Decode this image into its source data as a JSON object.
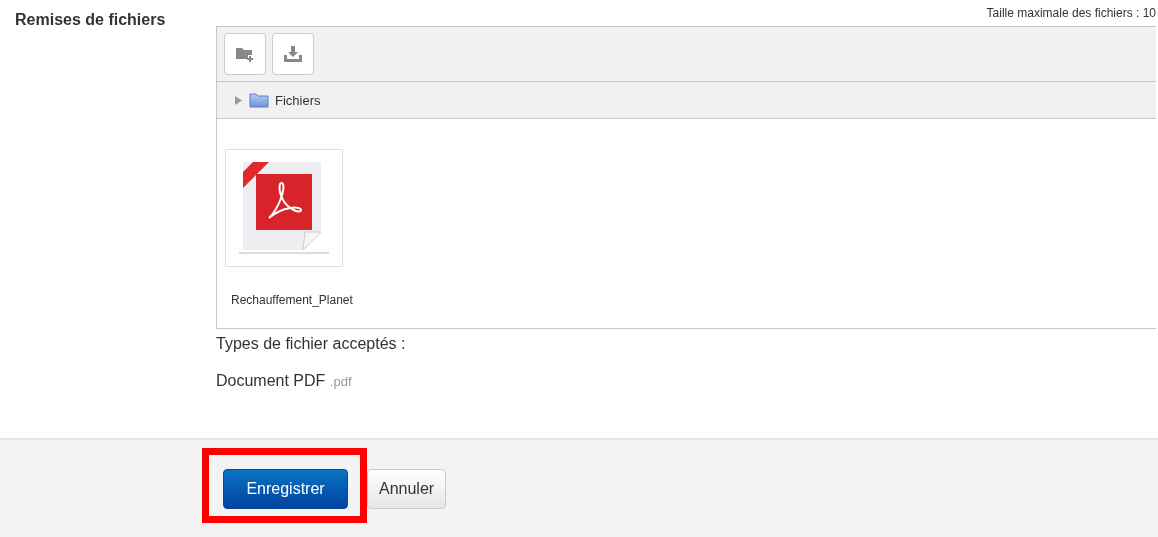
{
  "field_label": "Remises de fichiers",
  "max_size": "Taille maximale des fichiers : 10",
  "toolbar": [
    {
      "kind": "new-folder"
    },
    {
      "kind": "download"
    }
  ],
  "path": {
    "expanded": false,
    "folder": "Fichiers"
  },
  "files": [
    {
      "kind": "pdf",
      "name": "Rechauffement_Planet"
    }
  ],
  "accepted_label": "Types de fichier acceptés :",
  "accepted_types": [
    {
      "name": "Document PDF",
      "ext": ".pdf"
    }
  ],
  "buttons": [
    {
      "label": "Enregistrer",
      "kind": "primary",
      "highlighted": true
    },
    {
      "label": "Annuler",
      "kind": "default",
      "highlighted": false
    }
  ]
}
